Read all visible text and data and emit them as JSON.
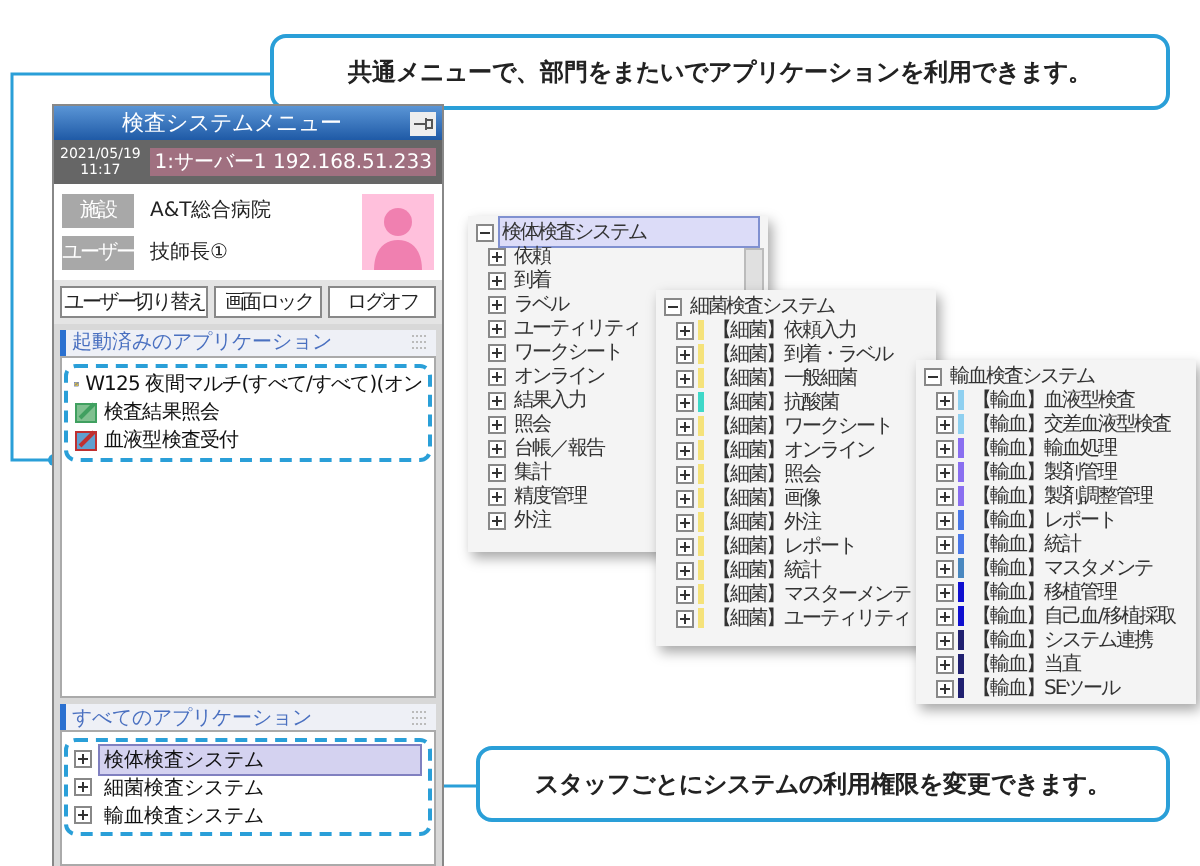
{
  "callouts": [
    {
      "text": "共通メニューで、部門をまたいでアプリケーションを利用できます。"
    },
    {
      "text": "スタッフごとにシステムの利用権限を変更できます。"
    }
  ],
  "app_menu": {
    "title": "検査システムメニュー",
    "date": "2021/05/19",
    "time": "11:17",
    "server": "1:サーバー1 192.168.51.233",
    "info": [
      {
        "label": "施設",
        "value": "A&T総合病院"
      },
      {
        "label": "ユーザー",
        "value": "技師長①"
      }
    ],
    "buttons": [
      "ユーザー切り替え",
      "画面ロック",
      "ログオフ"
    ],
    "running_section": "起動済みのアプリケーション",
    "running_apps": [
      {
        "label": "W125 夜間マルチ(すべて/すべて)(オン"
      },
      {
        "label": "検査結果照会"
      },
      {
        "label": "血液型検査受付"
      }
    ],
    "all_section": "すべてのアプリケーション",
    "all_apps": [
      {
        "label": "検体検査システム",
        "selected": true
      },
      {
        "label": "細菌検査システム",
        "selected": false
      },
      {
        "label": "輸血検査システム",
        "selected": false
      }
    ]
  },
  "tree_panels": [
    {
      "root": "検体検査システム",
      "selected": true,
      "items": [
        {
          "label": "依頼"
        },
        {
          "label": "到着"
        },
        {
          "label": "ラベル"
        },
        {
          "label": "ユーティリティ"
        },
        {
          "label": "ワークシート"
        },
        {
          "label": "オンライン"
        },
        {
          "label": "結果入力"
        },
        {
          "label": "照会"
        },
        {
          "label": "台帳／報告"
        },
        {
          "label": "集計"
        },
        {
          "label": "精度管理"
        },
        {
          "label": "外注"
        }
      ]
    },
    {
      "root": "細菌検査システム",
      "selected": false,
      "items": [
        {
          "label": "【細菌】依頼入力",
          "color": "#f5e27a"
        },
        {
          "label": "【細菌】到着・ラベル",
          "color": "#f5e27a"
        },
        {
          "label": "【細菌】一般細菌",
          "color": "#f5e27a"
        },
        {
          "label": "【細菌】抗酸菌",
          "color": "#3fd8c8"
        },
        {
          "label": "【細菌】ワークシート",
          "color": "#f5e27a"
        },
        {
          "label": "【細菌】オンライン",
          "color": "#f5e27a"
        },
        {
          "label": "【細菌】照会",
          "color": "#f5e27a"
        },
        {
          "label": "【細菌】画像",
          "color": "#f5e27a"
        },
        {
          "label": "【細菌】外注",
          "color": "#f5e27a"
        },
        {
          "label": "【細菌】レポート",
          "color": "#f5e27a"
        },
        {
          "label": "【細菌】統計",
          "color": "#f5e27a"
        },
        {
          "label": "【細菌】マスターメンテ",
          "color": "#f5e27a"
        },
        {
          "label": "【細菌】ユーティリティ",
          "color": "#f5e27a"
        }
      ]
    },
    {
      "root": "輸血検査システム",
      "selected": false,
      "items": [
        {
          "label": "【輸血】血液型検査",
          "color": "#8fd0f0"
        },
        {
          "label": "【輸血】交差血液型検査",
          "color": "#8fd0f0"
        },
        {
          "label": "【輸血】輸血処理",
          "color": "#8a6ff0"
        },
        {
          "label": "【輸血】製剤管理",
          "color": "#8a6ff0"
        },
        {
          "label": "【輸血】製剤調整管理",
          "color": "#8a6ff0"
        },
        {
          "label": "【輸血】レポート",
          "color": "#4a78e8"
        },
        {
          "label": "【輸血】統計",
          "color": "#4a78e8"
        },
        {
          "label": "【輸血】マスタメンテ",
          "color": "#4a88c0"
        },
        {
          "label": "【輸血】移植管理",
          "color": "#1010d0"
        },
        {
          "label": "【輸血】自己血/移植採取",
          "color": "#1010d0"
        },
        {
          "label": "【輸血】システム連携",
          "color": "#202070"
        },
        {
          "label": "【輸血】当直",
          "color": "#202070"
        },
        {
          "label": "【輸血】SEツール",
          "color": "#202070"
        }
      ]
    }
  ]
}
